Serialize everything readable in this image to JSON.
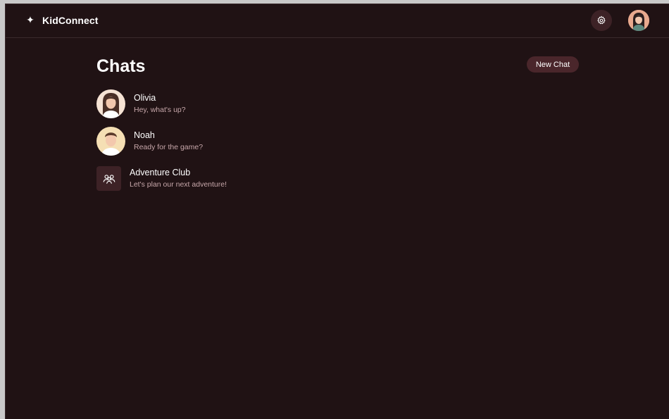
{
  "app": {
    "name": "KidConnect",
    "logo_icon": "sparkle-icon"
  },
  "header": {
    "settings_icon": "gear-icon",
    "profile_avatar": "user-avatar"
  },
  "main": {
    "title": "Chats",
    "new_chat_label": "New Chat",
    "chats": [
      {
        "name": "Olivia",
        "preview": "Hey, what's up?",
        "avatar": "olivia-avatar"
      },
      {
        "name": "Noah",
        "preview": "Ready for the game?",
        "avatar": "noah-avatar"
      },
      {
        "name": "Adventure Club",
        "preview": "Let's plan our next adventure!",
        "avatar": "group-icon"
      }
    ]
  },
  "colors": {
    "background": "#201214",
    "accent": "#4a262b",
    "icon_button": "#3d2226",
    "preview_text": "#c7a7aa"
  }
}
